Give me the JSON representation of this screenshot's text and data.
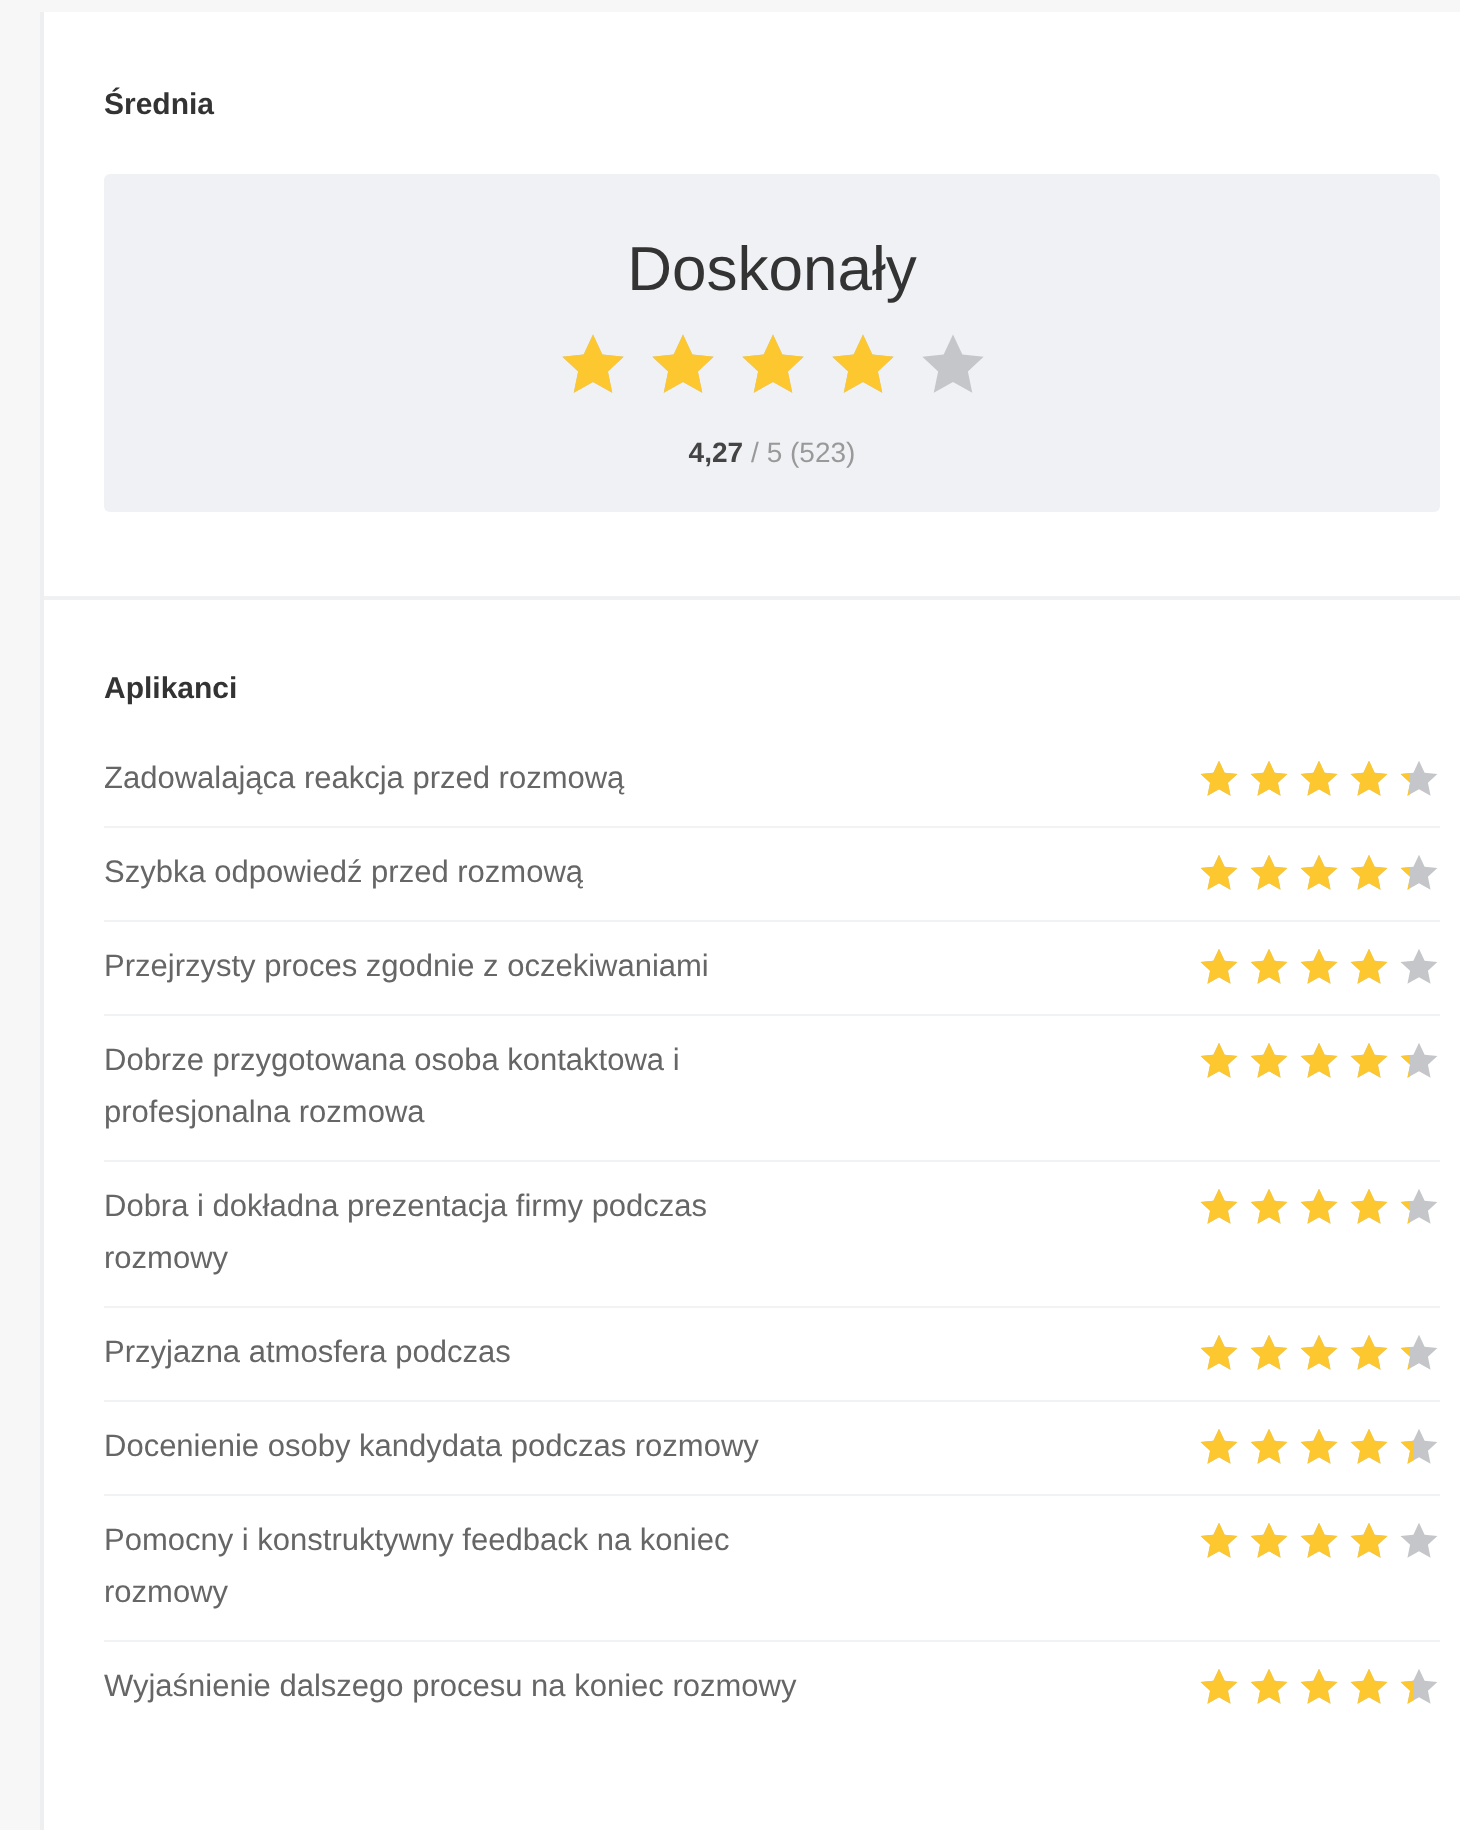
{
  "average": {
    "heading": "Średnia",
    "label": "Doskonały",
    "stars": 4,
    "score": "4,27",
    "scale": "/ 5 (523)"
  },
  "applicants": {
    "heading": "Aplikanci",
    "items": [
      {
        "label": "Zadowalająca reakcja przed rozmową",
        "stars": 4.3
      },
      {
        "label": "Szybka odpowiedź przed rozmową",
        "stars": 4.3
      },
      {
        "label": "Przejrzysty proces zgodnie z oczekiwaniami",
        "stars": 4.1
      },
      {
        "label": "Dobrze przygotowana osoba kontaktowa i profesjonalna rozmowa",
        "stars": 4.3
      },
      {
        "label": "Dobra i dokładna prezentacja firmy podczas rozmowy",
        "stars": 4.3
      },
      {
        "label": "Przyjazna atmosfera podczas",
        "stars": 4.3
      },
      {
        "label": "Docenienie osoby kandydata podczas rozmowy",
        "stars": 4.4
      },
      {
        "label": "Pomocny i konstruktywny feedback na koniec rozmowy",
        "stars": 4.1
      },
      {
        "label": "Wyjaśnienie dalszego procesu na koniec rozmowy",
        "stars": 4.4
      }
    ]
  }
}
